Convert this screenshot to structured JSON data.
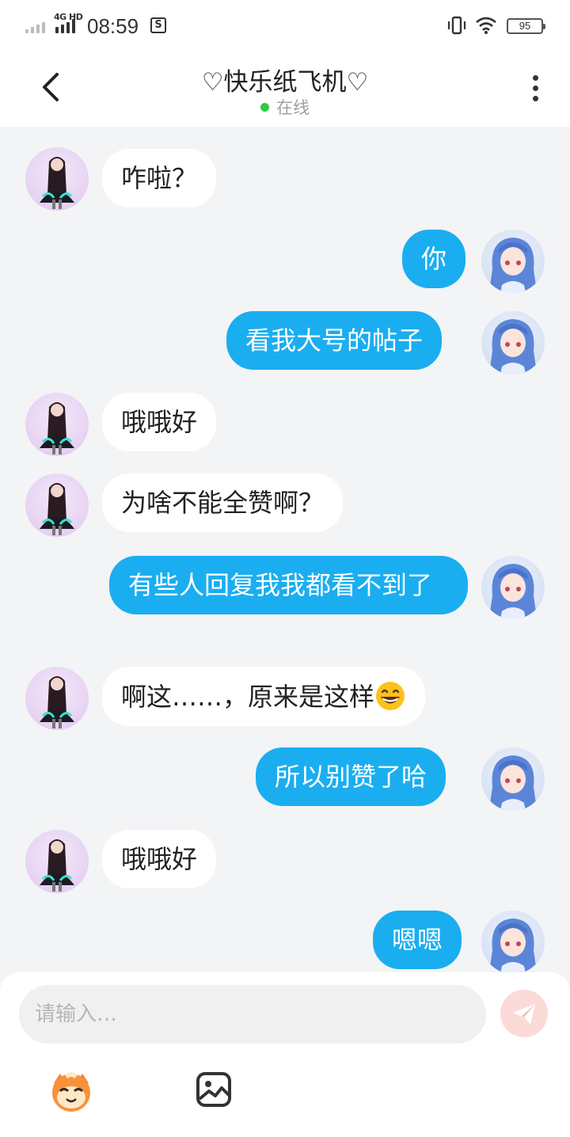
{
  "status_bar": {
    "network": "4G HD",
    "time": "08:59",
    "battery": "95",
    "notification_icon": "s-badge-icon"
  },
  "header": {
    "title": "♡快乐纸飞机♡",
    "status": "在线",
    "status_color": "#2ecc40"
  },
  "messages": [
    {
      "from": "other",
      "text": "咋啦？"
    },
    {
      "from": "me",
      "text": "你"
    },
    {
      "from": "me",
      "text": "看我大号的帖子"
    },
    {
      "from": "other",
      "text": "哦哦好"
    },
    {
      "from": "other",
      "text": "为啥不能全赞啊？"
    },
    {
      "from": "me",
      "text": "有些人回复我我都看不到了"
    },
    {
      "from": "other",
      "text": "啊这……，原来是这样",
      "emoji": "grinning-face-emoji"
    },
    {
      "from": "me",
      "text": "所以别赞了哈"
    },
    {
      "from": "other",
      "text": "哦哦好"
    },
    {
      "from": "me",
      "text": "嗯嗯"
    }
  ],
  "input": {
    "placeholder": "请输入…"
  },
  "colors": {
    "my_bubble": "#1aaef0",
    "other_bubble": "#ffffff",
    "background": "#f3f4f6",
    "send_button": "#fcdad8"
  },
  "icons": [
    "back-arrow-icon",
    "more-icon",
    "send-icon",
    "emoji-mascot-icon",
    "image-icon",
    "vibrate-icon",
    "wifi-icon"
  ]
}
